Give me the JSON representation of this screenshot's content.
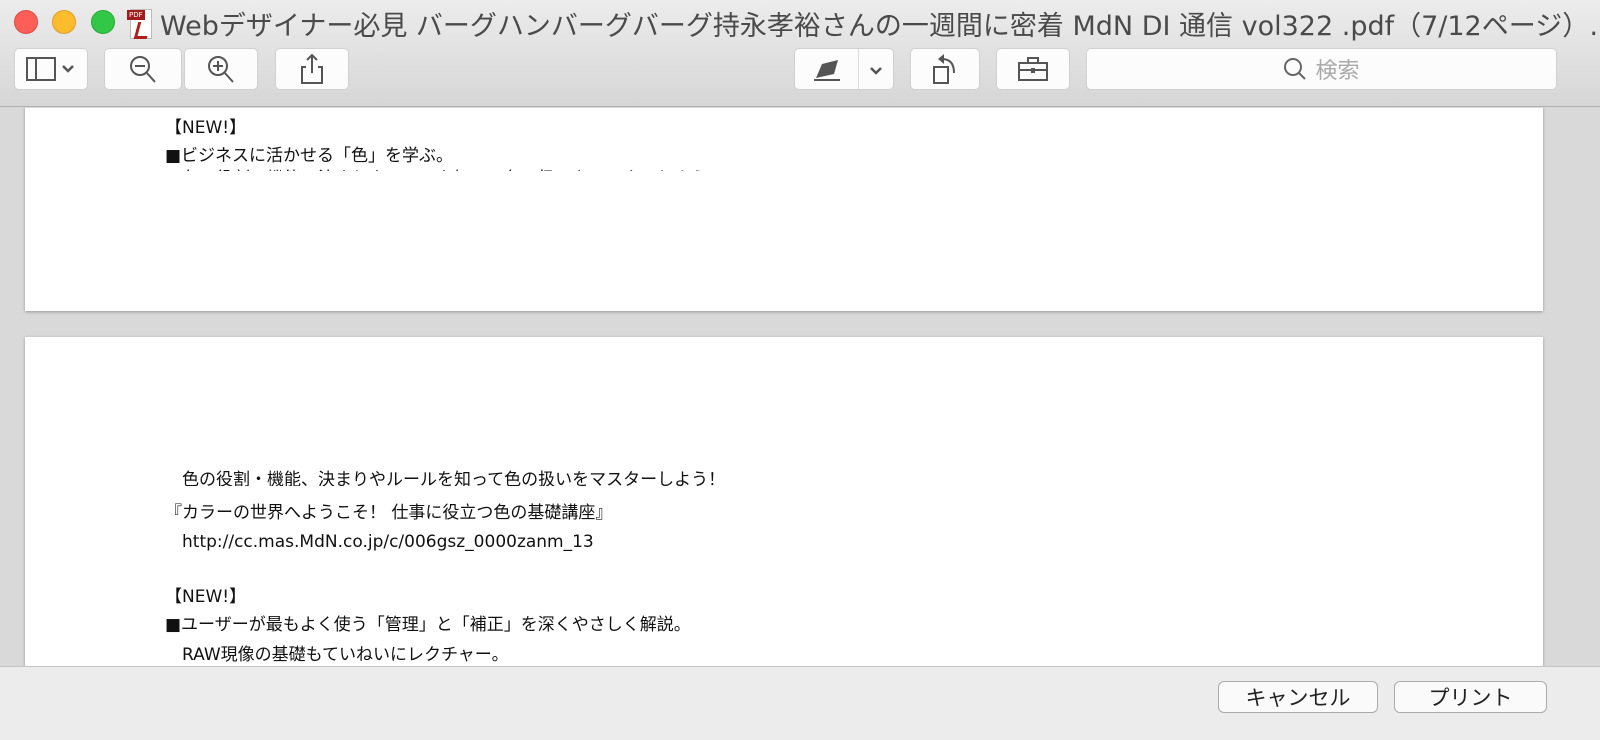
{
  "window": {
    "title": "Webデザイナー必見 バーグハンバーグバーグ持永孝裕さんの一週間に密着 MdN DI 通信 vol322 .pdf（7/12ページ）…"
  },
  "toolbar": {
    "search_placeholder": "検索"
  },
  "page1": {
    "lines": [
      "【NEW!】",
      "■ビジネスに活かせる「色」を学ぶ。",
      "　色の役割・機能、決まりやルールを知って色の扱いをマスターしよう！"
    ]
  },
  "page2": {
    "lines": [
      "　色の役割・機能、決まりやルールを知って色の扱いをマスターしよう！",
      "『カラーの世界へようこそ！ 仕事に役立つ色の基礎講座』",
      "　http://cc.mas.MdN.co.jp/c/006gsz_0000zanm_13",
      "【NEW!】",
      "■ユーザーが最もよく使う「管理」と「補正」を深くやさしく解説。",
      "　RAW現像の基礎もていねいにレクチャー。"
    ]
  },
  "footer": {
    "cancel": "キャンセル",
    "print": "プリント"
  },
  "colors": {
    "close": "#fc5f57",
    "minimize": "#fdbc2e",
    "zoom": "#33c748"
  }
}
